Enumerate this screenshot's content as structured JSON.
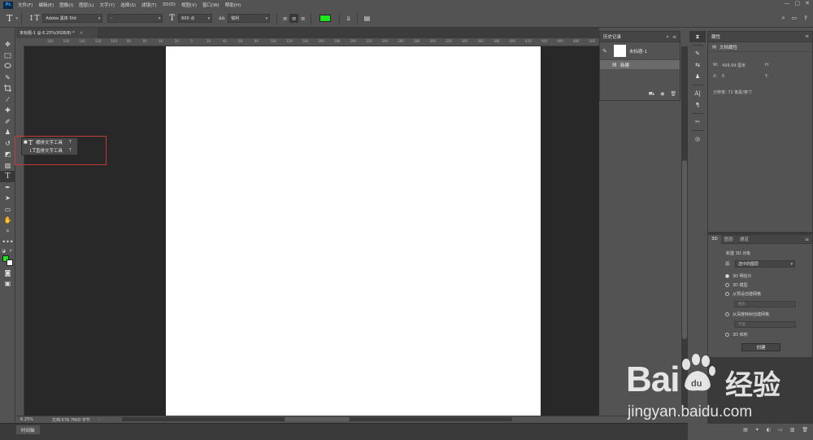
{
  "menubar": {
    "logo": "Ps",
    "items": [
      "文件(F)",
      "编辑(E)",
      "图像(I)",
      "图层(L)",
      "文字(Y)",
      "选择(S)",
      "滤镜(T)",
      "3D(D)",
      "视图(V)",
      "窗口(W)",
      "帮助(H)"
    ]
  },
  "options": {
    "tool_glyph": "T",
    "orient_glyph": "↕T",
    "font_family": "Adobe 黑体 Std",
    "font_style": "-",
    "size_glyph": "T",
    "font_size": "600 点",
    "aa_glyph": "aa",
    "antialias": "锐利",
    "text_color": "#1ee61e",
    "warp_glyph": "⫫",
    "panel_glyph": "▤",
    "search_glyph": "⌕",
    "workspace_glyph": "▭",
    "share_glyph": "⇪"
  },
  "window": {
    "min": "—",
    "max": "▢",
    "close": "✕"
  },
  "document": {
    "tab_title": "未标题-1 @ 6.25%(RGB/8) *",
    "close_glyph": "×",
    "zoom": "6.25%",
    "doc_info": "文档:576.7M/0 字节",
    "status_arrow": "›"
  },
  "ruler": {
    "h_labels": [
      "180",
      "160",
      "140",
      "120",
      "100",
      "80",
      "60",
      "40",
      "20",
      "0",
      "20",
      "40",
      "60",
      "80",
      "100",
      "120",
      "140",
      "160",
      "180",
      "200",
      "220",
      "240",
      "260",
      "280",
      "300",
      "320",
      "340",
      "360",
      "380",
      "400",
      "420",
      "440",
      "460",
      "480",
      "500",
      "520"
    ]
  },
  "flyout": {
    "items": [
      {
        "dot": "■",
        "glyph": "T",
        "label": "横排文字工具",
        "key": "T"
      },
      {
        "dot": "",
        "glyph": "↓T",
        "label": "直排文字工具",
        "key": "T"
      }
    ]
  },
  "history": {
    "title": "历史记录",
    "menu_glyph": "≡",
    "snapshot_name": "未标题-1",
    "state_name": "新建",
    "footer_glyphs": [
      "⛟",
      "◉",
      "🗑"
    ]
  },
  "properties": {
    "title": "属性",
    "menu_glyph": "≡",
    "subtitle": "文档属性",
    "w_label": "W:",
    "w_value": "499.99 厘米",
    "h_label": "H:",
    "x_label": "X:",
    "x_value": "0",
    "y_label": "Y:",
    "resolution": "分辨率: 72 像素/英寸"
  },
  "panel3d": {
    "tabs": [
      "3D",
      "图层",
      "通道"
    ],
    "menu_glyph": "≡",
    "new_object": "新建 3D 对象",
    "source_label": "源:",
    "source_value": "选中的图层",
    "options": [
      "3D 明信片",
      "3D 模型",
      "从预设创建网格",
      "从深度映射创建网格",
      "3D 体积"
    ],
    "field1": "锥形",
    "field2": "平面",
    "create": "创建"
  },
  "timeline": {
    "tab": "时间轴"
  },
  "right_footer_glyphs": [
    "▤",
    "✦",
    "◐",
    "▭",
    "▥",
    "🗑"
  ],
  "watermark": {
    "brand": "Bai",
    "cn": "经验",
    "url": "jingyan.baidu.com",
    "paw": "du"
  }
}
